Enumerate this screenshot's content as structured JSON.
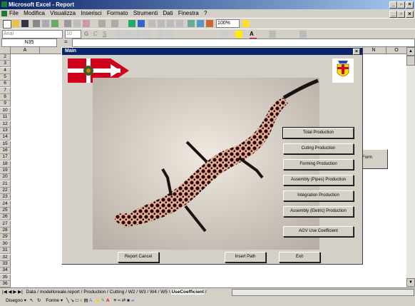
{
  "window": {
    "title": "Microsoft Excel - Report"
  },
  "menu": [
    "File",
    "Modifica",
    "Visualizza",
    "Inserisci",
    "Formato",
    "Strumenti",
    "Dati",
    "Finestra",
    "?"
  ],
  "format_toolbar": {
    "font": "Arial",
    "size": "10"
  },
  "zoom": "100%",
  "formula_bar": {
    "name_box": "N35",
    "fx": "="
  },
  "columns": [
    "A",
    "N",
    "O"
  ],
  "rows": [
    "2",
    "3",
    "4",
    "5",
    "6",
    "7",
    "8",
    "9",
    "10",
    "11",
    "12",
    "13",
    "14",
    "15",
    "16",
    "17",
    "18",
    "19",
    "20",
    "21",
    "22",
    "23",
    "24",
    "25",
    "26",
    "27",
    "28",
    "29",
    "30",
    "31",
    "32",
    "33",
    "34",
    "35",
    "36"
  ],
  "sheet_button": {
    "label": "Form"
  },
  "sheet_tabs": [
    "Data",
    "modelloreale.report",
    "Production",
    "Cutting",
    "W2",
    "W3",
    "W4",
    "W5",
    "UseCoefficient"
  ],
  "draw_toolbar": {
    "draw_label": "Disegno",
    "shapes_label": "Forme"
  },
  "dialog": {
    "title": "Main",
    "close": "×",
    "side_buttons": [
      "Total Production",
      "Cuting Production",
      "Forming Production",
      "Assembly (Pipes) Production",
      "Integration Production",
      "Assembly (Eletric) Production",
      "AGV Use Coefficient"
    ],
    "bottom_buttons": [
      "Report Cancel",
      "Insert Path",
      "Exit"
    ]
  },
  "colors": {
    "titlebar": "#0a246a",
    "sheet_bg": "#ffffff",
    "dialog_bg": "#d4d0c8",
    "flag_red": "#d0021b"
  }
}
